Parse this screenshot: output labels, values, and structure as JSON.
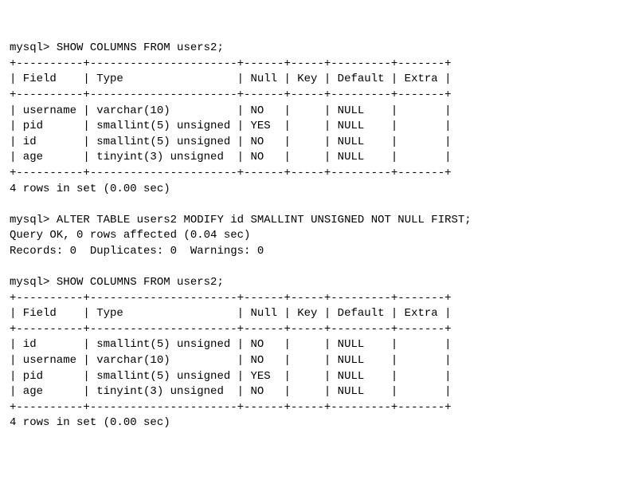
{
  "prompt": "mysql>",
  "cmd1": "SHOW COLUMNS FROM users2;",
  "border1": "+----------+----------------------+------+-----+---------+-------+",
  "header1": "| Field    | Type                 | Null | Key | Default | Extra |",
  "table1_rows": [
    "| username | varchar(10)          | NO   |     | NULL    |       |",
    "| pid      | smallint(5) unsigned | YES  |     | NULL    |       |",
    "| id       | smallint(5) unsigned | NO   |     | NULL    |       |",
    "| age      | tinyint(3) unsigned  | NO   |     | NULL    |       |"
  ],
  "footer1": "4 rows in set (0.00 sec)",
  "cmd2": "ALTER TABLE users2 MODIFY id SMALLINT UNSIGNED NOT NULL FIRST;",
  "result2a": "Query OK, 0 rows affected (0.04 sec)",
  "result2b": "Records: 0  Duplicates: 0  Warnings: 0",
  "cmd3": "SHOW COLUMNS FROM users2;",
  "border2": "+----------+----------------------+------+-----+---------+-------+",
  "header2": "| Field    | Type                 | Null | Key | Default | Extra |",
  "table2_rows": [
    "| id       | smallint(5) unsigned | NO   |     | NULL    |       |",
    "| username | varchar(10)          | NO   |     | NULL    |       |",
    "| pid      | smallint(5) unsigned | YES  |     | NULL    |       |",
    "| age      | tinyint(3) unsigned  | NO   |     | NULL    |       |"
  ],
  "footer2": "4 rows in set (0.00 sec)",
  "chart_data": {
    "type": "table",
    "tables": [
      {
        "title": "SHOW COLUMNS FROM users2 (before ALTER)",
        "columns": [
          "Field",
          "Type",
          "Null",
          "Key",
          "Default",
          "Extra"
        ],
        "rows": [
          [
            "username",
            "varchar(10)",
            "NO",
            "",
            "NULL",
            ""
          ],
          [
            "pid",
            "smallint(5) unsigned",
            "YES",
            "",
            "NULL",
            ""
          ],
          [
            "id",
            "smallint(5) unsigned",
            "NO",
            "",
            "NULL",
            ""
          ],
          [
            "age",
            "tinyint(3) unsigned",
            "NO",
            "",
            "NULL",
            ""
          ]
        ]
      },
      {
        "title": "SHOW COLUMNS FROM users2 (after ALTER)",
        "columns": [
          "Field",
          "Type",
          "Null",
          "Key",
          "Default",
          "Extra"
        ],
        "rows": [
          [
            "id",
            "smallint(5) unsigned",
            "NO",
            "",
            "NULL",
            ""
          ],
          [
            "username",
            "varchar(10)",
            "NO",
            "",
            "NULL",
            ""
          ],
          [
            "pid",
            "smallint(5) unsigned",
            "YES",
            "",
            "NULL",
            ""
          ],
          [
            "age",
            "tinyint(3) unsigned",
            "NO",
            "",
            "NULL",
            ""
          ]
        ]
      }
    ]
  }
}
